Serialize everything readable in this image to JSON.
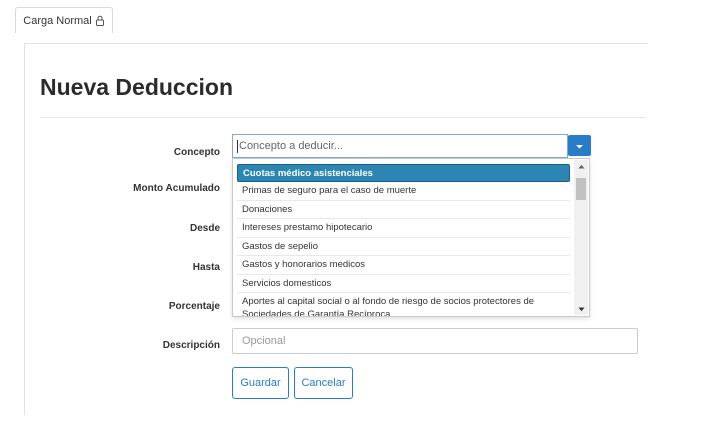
{
  "tab": {
    "label": "Carga Normal",
    "icon": "lock-icon"
  },
  "page": {
    "title": "Nueva Deduccion"
  },
  "form": {
    "labels": {
      "concepto": "Concepto",
      "monto": "Monto Acumulado",
      "desde": "Desde",
      "hasta": "Hasta",
      "porcentaje": "Porcentaje",
      "descripcion": "Descripción"
    },
    "concepto_placeholder": "Concepto a deducir...",
    "descripcion_placeholder": "Opcional"
  },
  "dropdown": {
    "options": [
      "Cuotas médico asistenciales",
      "Primas de seguro para el caso de muerte",
      "Donaciones",
      "Intereses prestamo hipotecario",
      "Gastos de sepelio",
      "Gastos y honorarios medicos",
      "Servicios domesticos",
      "Aportes al capital social o al fondo de riesgo de socios protectores de Sociedades de Garantía Recíproca"
    ],
    "highlighted_index": 0
  },
  "buttons": {
    "save": "Guardar",
    "cancel": "Cancelar"
  },
  "colors": {
    "accent": "#2a7cc7",
    "highlight": "#2b86b3"
  }
}
